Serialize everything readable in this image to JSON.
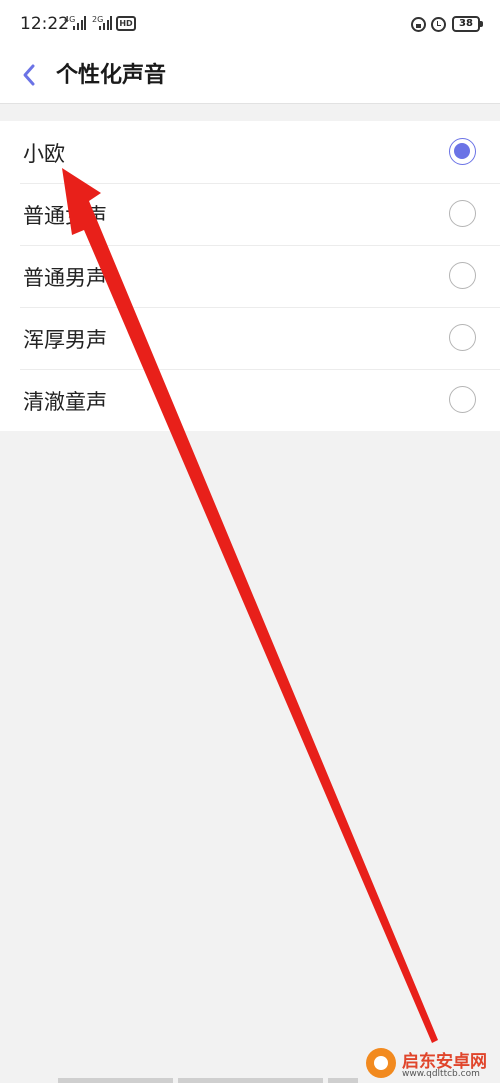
{
  "status_bar": {
    "time": "12:22",
    "network_1": "4G",
    "network_2": "2G",
    "hd_label": "HD",
    "battery_level": "38"
  },
  "header": {
    "title": "个性化声音"
  },
  "voices": [
    {
      "label": "小欧",
      "selected": true
    },
    {
      "label": "普通女声",
      "selected": false
    },
    {
      "label": "普通男声",
      "selected": false
    },
    {
      "label": "浑厚男声",
      "selected": false
    },
    {
      "label": "清澈童声",
      "selected": false
    }
  ],
  "colors": {
    "accent": "#6b73e6",
    "annotation_arrow": "#e8201a"
  },
  "watermark": {
    "name": "启东安卓网",
    "url": "www.qdlttcb.com"
  }
}
